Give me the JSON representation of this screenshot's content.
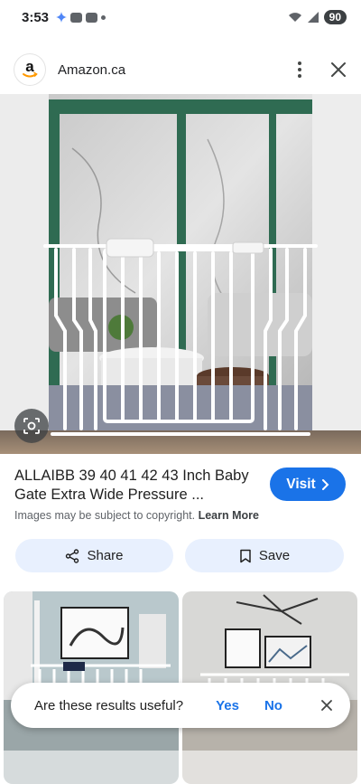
{
  "status_bar": {
    "time": "3:53",
    "battery": "90"
  },
  "header": {
    "site_name": "Amazon.ca",
    "logo_letter": "a",
    "menu_icon": "more-vert-icon",
    "close_icon": "close-icon"
  },
  "result": {
    "title": "ALLAIBB 39 40 41 42 43 Inch Baby Gate Extra Wide Pressure ...",
    "visit_label": "Visit",
    "copyright_text": "Images may be subject to copyright.",
    "learn_more": "Learn More",
    "share_label": "Share",
    "save_label": "Save"
  },
  "feedback": {
    "question": "Are these results useful?",
    "yes": "Yes",
    "no": "No"
  },
  "colors": {
    "accent": "#1a73e8",
    "pill_bg": "#e8f0fe",
    "amazon_orange": "#ff9900"
  }
}
